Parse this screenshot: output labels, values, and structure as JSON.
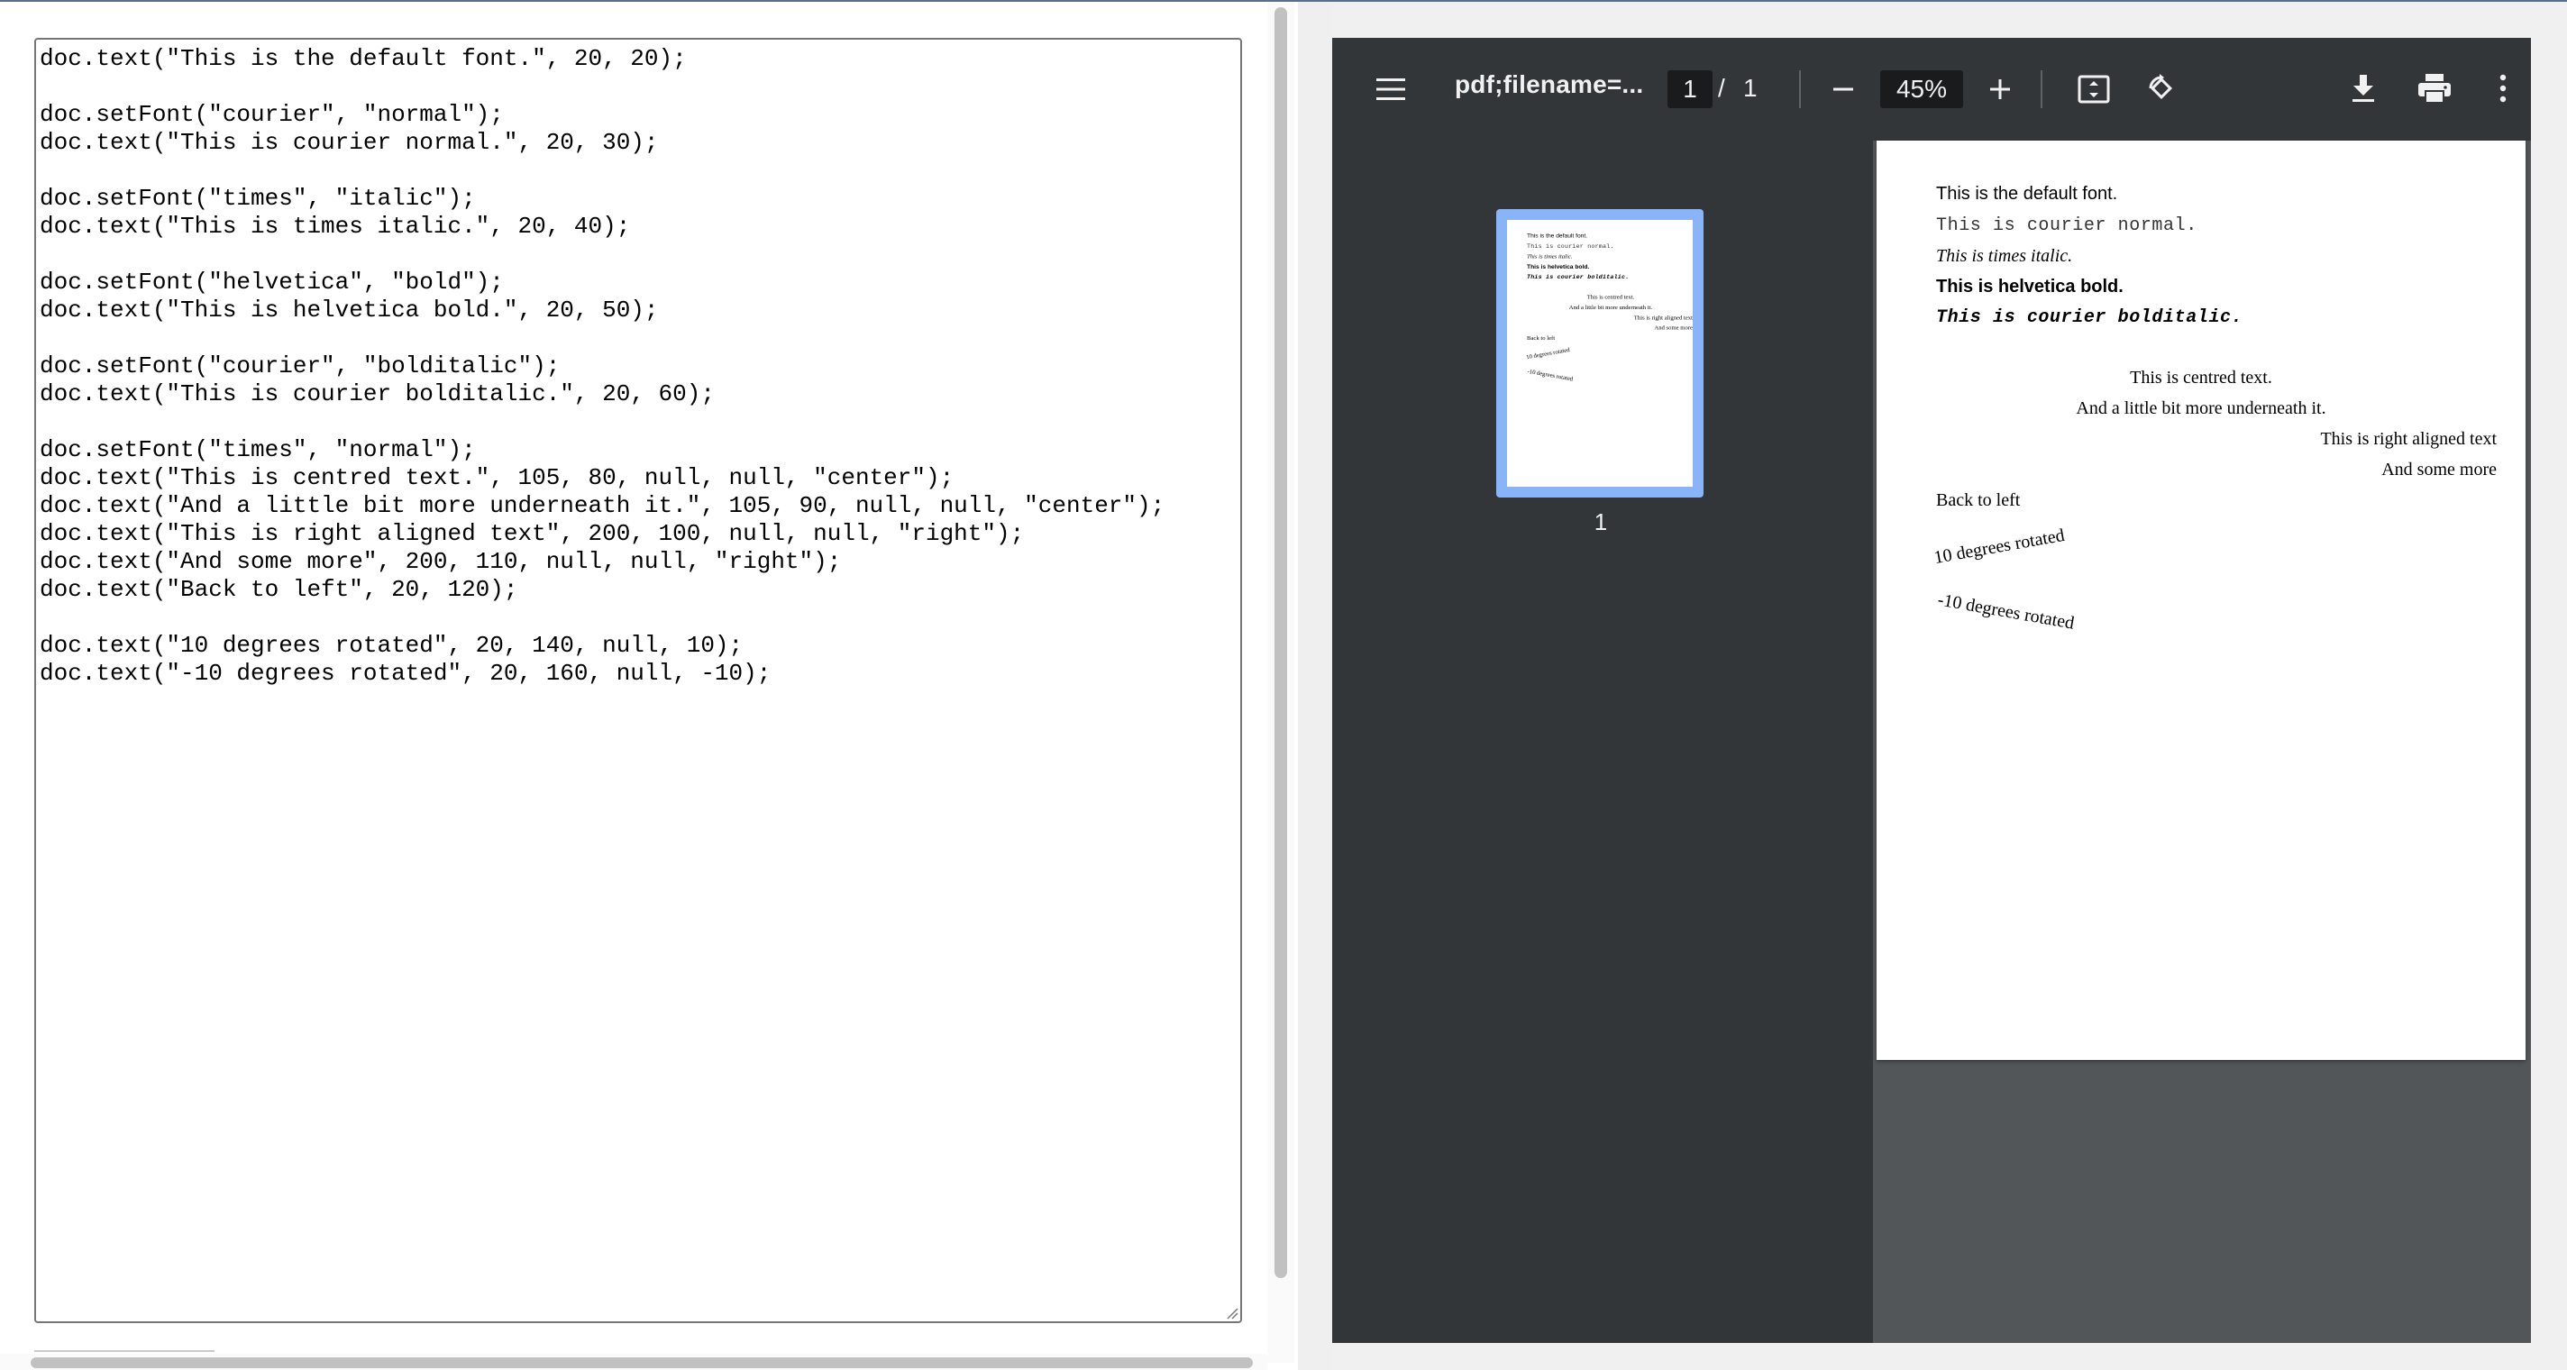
{
  "editor": {
    "code": "doc.text(\"This is the default font.\", 20, 20);\n\ndoc.setFont(\"courier\", \"normal\");\ndoc.text(\"This is courier normal.\", 20, 30);\n\ndoc.setFont(\"times\", \"italic\");\ndoc.text(\"This is times italic.\", 20, 40);\n\ndoc.setFont(\"helvetica\", \"bold\");\ndoc.text(\"This is helvetica bold.\", 20, 50);\n\ndoc.setFont(\"courier\", \"bolditalic\");\ndoc.text(\"This is courier bolditalic.\", 20, 60);\n\ndoc.setFont(\"times\", \"normal\");\ndoc.text(\"This is centred text.\", 105, 80, null, null, \"center\");\ndoc.text(\"And a little bit more underneath it.\", 105, 90, null, null, \"center\");\ndoc.text(\"This is right aligned text\", 200, 100, null, null, \"right\");\ndoc.text(\"And some more\", 200, 110, null, null, \"right\");\ndoc.text(\"Back to left\", 20, 120);\n\ndoc.text(\"10 degrees rotated\", 20, 140, null, 10);\ndoc.text(\"-10 degrees rotated\", 20, 160, null, -10);"
  },
  "viewer": {
    "title": "pdf;filename=...",
    "current_page": "1",
    "page_separator": "/",
    "total_pages": "1",
    "zoom": "45%",
    "thumbnail_label": "1",
    "icons": {
      "menu": "menu-icon",
      "zoom_out": "minus-icon",
      "zoom_in": "plus-icon",
      "fit": "fit-to-page-icon",
      "rotate": "rotate-icon",
      "download": "download-icon",
      "print": "print-icon",
      "more": "more-vert-icon"
    }
  },
  "pdf": {
    "line1": "This is the default font.",
    "line2": "This is courier normal.",
    "line3": "This is times italic.",
    "line4": "This is helvetica bold.",
    "line5": "This is courier bolditalic.",
    "line6": "This is centred text.",
    "line7": "And a little bit more underneath it.",
    "line8": "This is right aligned text",
    "line9": "And some more",
    "line10": "Back to left",
    "line11": "10 degrees rotated",
    "line12": "-10 degrees rotated"
  }
}
